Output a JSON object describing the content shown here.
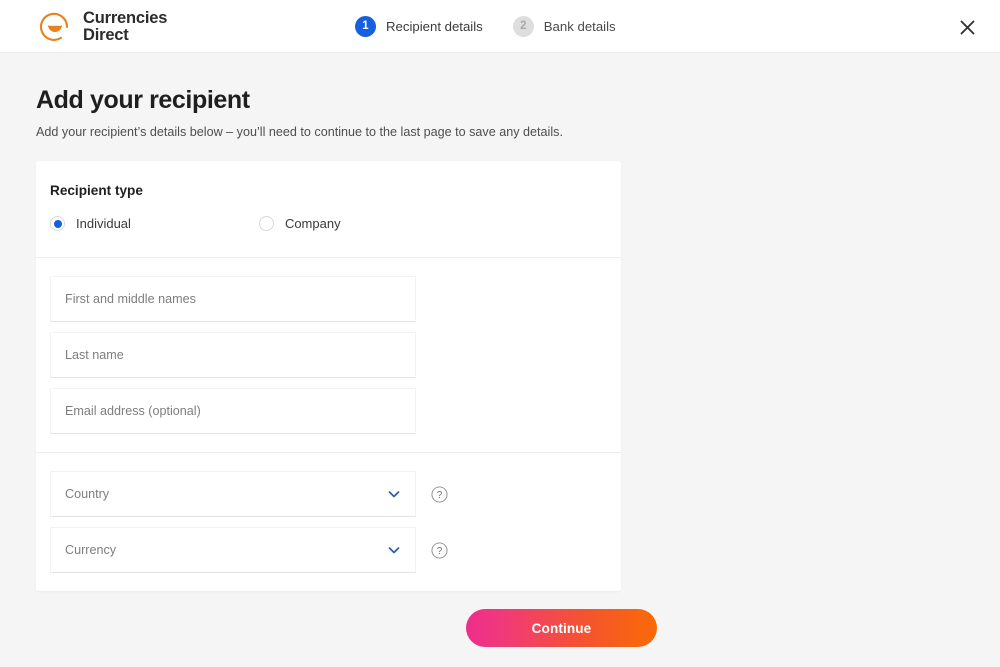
{
  "header": {
    "logo": {
      "icon": "currencies-direct-logo-icon",
      "text": "Currencies\nDirect",
      "color": "#e8821e"
    },
    "steps": [
      {
        "number": "1",
        "label": "Recipient details",
        "state": "active"
      },
      {
        "number": "2",
        "label": "Bank details",
        "state": "inactive"
      }
    ],
    "close": {
      "icon": "close-icon",
      "label": "✕"
    }
  },
  "page": {
    "title": "Add your recipient",
    "subtitle": "Add your recipient’s details below – you’ll need to continue to the last page to save any details."
  },
  "recipient_type": {
    "title": "Recipient type",
    "options": [
      {
        "label": "Individual",
        "selected": true
      },
      {
        "label": "Company",
        "selected": false
      }
    ]
  },
  "form": {
    "name_fields": [
      {
        "name": "first-and-middle-names",
        "placeholder": "First and middle names",
        "value": ""
      },
      {
        "name": "last-name",
        "placeholder": "Last name",
        "value": ""
      },
      {
        "name": "email-address",
        "placeholder": "Email address (optional)",
        "value": ""
      }
    ],
    "select_fields": [
      {
        "name": "country",
        "placeholder": "Country",
        "value": "",
        "help": "?"
      },
      {
        "name": "currency",
        "placeholder": "Currency",
        "value": "",
        "help": "?"
      }
    ]
  },
  "footer": {
    "continue_label": "Continue"
  },
  "colors": {
    "accent_blue": "#1460e0",
    "gradient_start": "#ee2d8a",
    "gradient_end": "#f96a06",
    "page_bg": "#f5f5f5",
    "logo_orange": "#e8821e"
  }
}
